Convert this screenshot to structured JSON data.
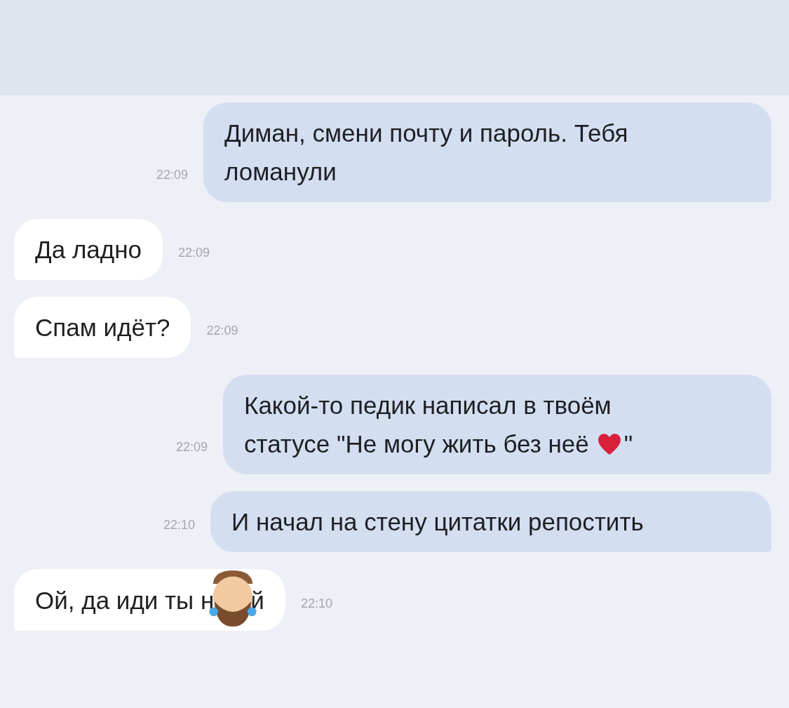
{
  "messages": [
    {
      "kind": "outgoing",
      "time": "22:09",
      "lines": [
        [
          {
            "kind": "text",
            "text": "Диман, смени почту и пароль. Тебя"
          }
        ],
        [
          {
            "kind": "text",
            "text": "ломанули"
          }
        ]
      ]
    },
    {
      "kind": "incoming",
      "time": "22:09",
      "lines": [
        [
          {
            "kind": "text",
            "text": "Да ладно"
          }
        ]
      ]
    },
    {
      "kind": "incoming",
      "time": "22:09",
      "lines": [
        [
          {
            "kind": "text",
            "text": "Спам идёт?"
          }
        ]
      ]
    },
    {
      "kind": "outgoing",
      "time": "22:09",
      "lines": [
        [
          {
            "kind": "text",
            "text": "Какой-то педик написал в твоём"
          }
        ],
        [
          {
            "kind": "text",
            "text": "статусе \"Не могу жить без неё"
          },
          {
            "kind": "heart"
          },
          {
            "kind": "text",
            "text": "\""
          }
        ]
      ]
    },
    {
      "kind": "outgoing",
      "time": "22:10",
      "lines": [
        [
          {
            "kind": "text",
            "text": "И начал на стену цитатки репостить"
          }
        ]
      ]
    },
    {
      "kind": "incoming",
      "time": "22:10",
      "lines": [
        [
          {
            "kind": "text",
            "text": "Ой, да иди ты н"
          },
          {
            "kind": "sticker"
          },
          {
            "kind": "text",
            "text": "й"
          }
        ]
      ]
    }
  ]
}
